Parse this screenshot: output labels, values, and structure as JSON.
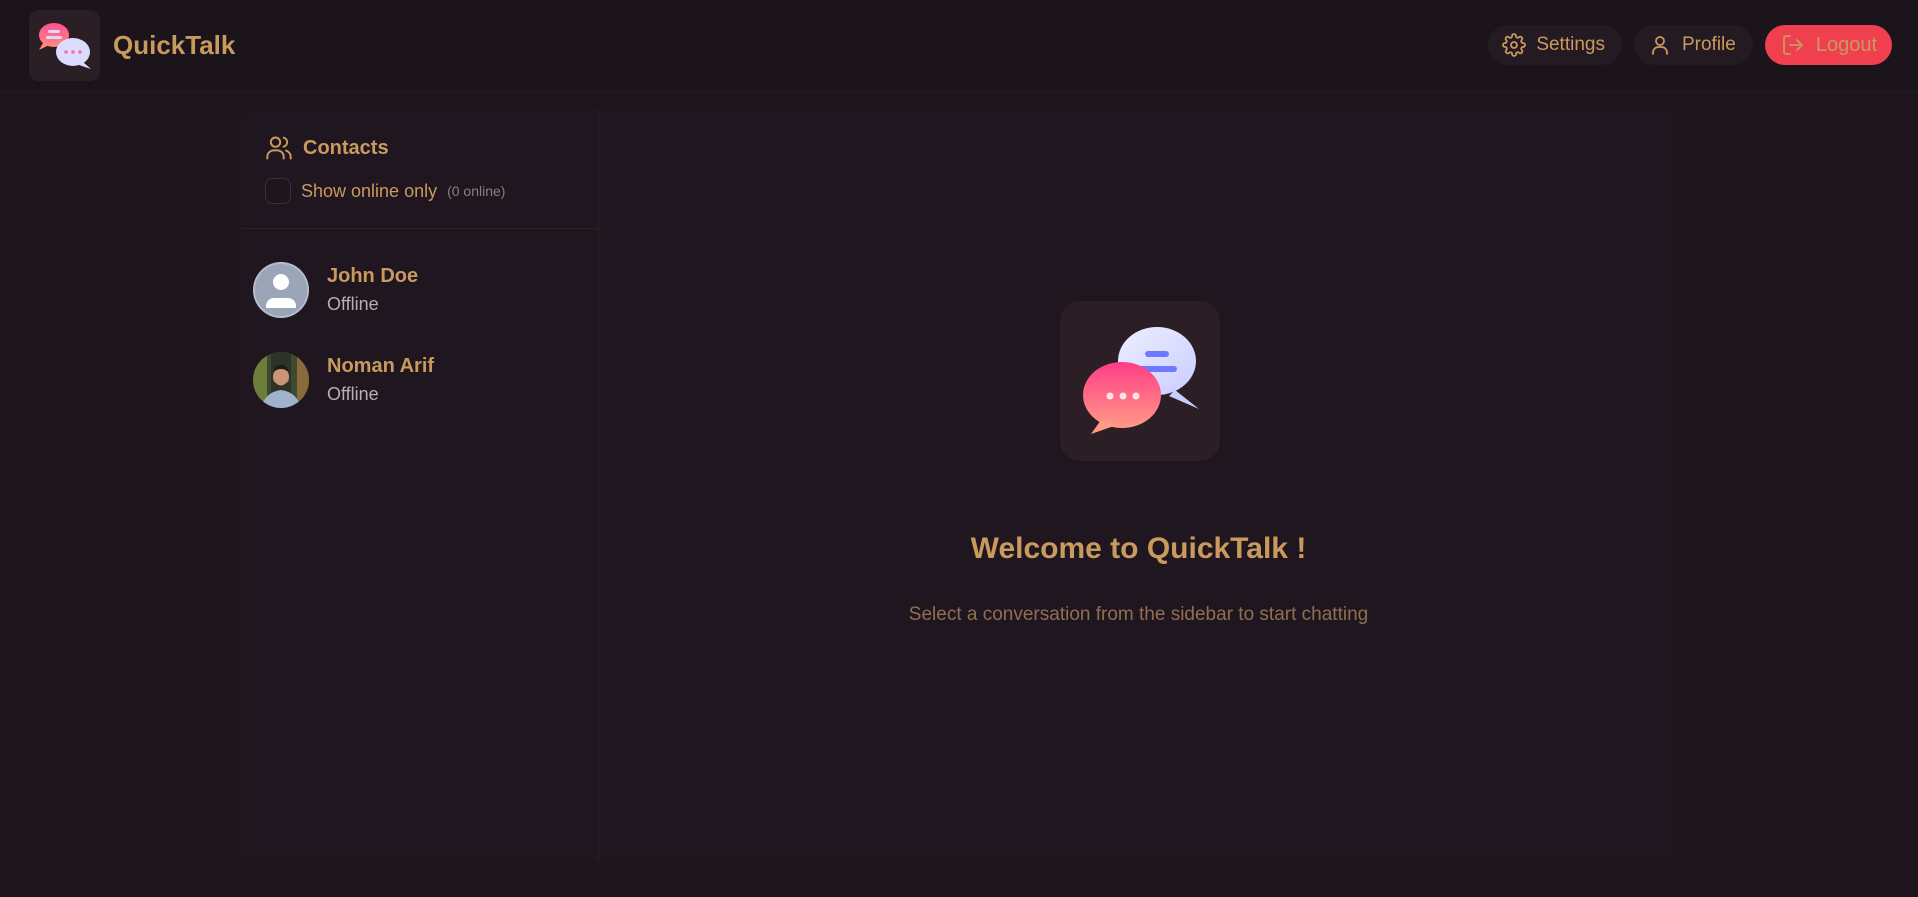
{
  "app": {
    "name": "QuickTalk",
    "logo_icon": "chat-bubbles-logo"
  },
  "header": {
    "settings_label": "Settings",
    "profile_label": "Profile",
    "logout_label": "Logout"
  },
  "sidebar": {
    "title": "Contacts",
    "filter_label": "Show online only",
    "online_count": "(0 online)",
    "contacts": [
      {
        "name": "John Doe",
        "status": "Offline",
        "avatar": "default-avatar"
      },
      {
        "name": "Noman Arif",
        "status": "Offline",
        "avatar": "photo-avatar"
      }
    ]
  },
  "welcome": {
    "title": "Welcome to QuickTalk !",
    "subtitle": "Select a conversation from the sidebar to start chatting"
  },
  "colors": {
    "background": "#1e151d",
    "accent": "#c99a5e",
    "logout": "#f0404f"
  }
}
